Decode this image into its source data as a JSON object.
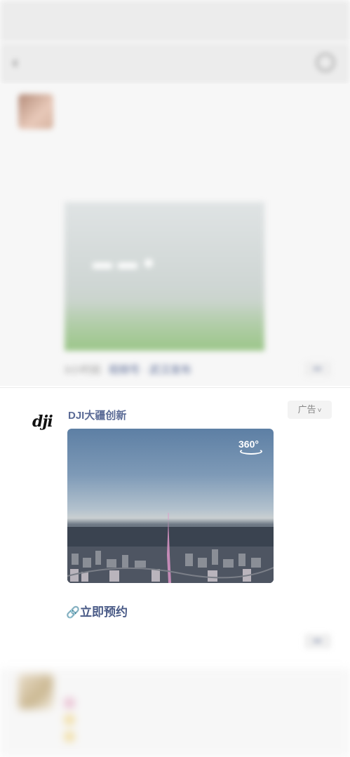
{
  "colors": {
    "link": "#5b6b96",
    "meta": "#9a9a9a",
    "background": "#f7f7f7"
  },
  "status_bar": {
    "time": "",
    "icons": ""
  },
  "nav": {
    "back_icon": "chevron-left-icon",
    "title": "",
    "action_icon": "more-icon"
  },
  "post1": {
    "author": "",
    "text": "",
    "time": "3小时前",
    "source": "视频号 · 武汉发布",
    "more_label": "••"
  },
  "ad_post": {
    "brand_logo": "dji",
    "name": "DJI大疆创新",
    "ad_label": "广告",
    "badge_360": "360°",
    "cta_label": "立即预约",
    "time": "",
    "reservations": "",
    "more_label": "••"
  },
  "post3": {
    "author": "",
    "lines": []
  }
}
